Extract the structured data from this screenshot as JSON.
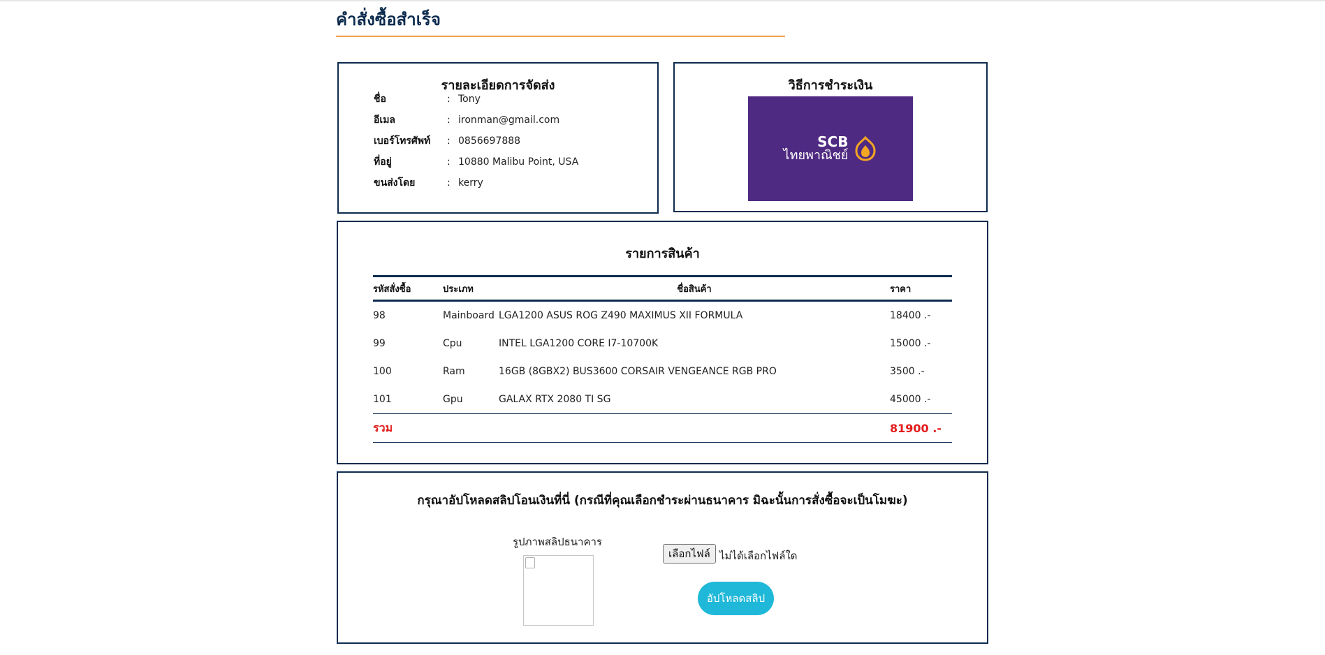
{
  "page": {
    "title": "คำสั่งซื้อสำเร็จ"
  },
  "shipping": {
    "heading": "รายละเอียดการจัดส่ง",
    "colon": ":",
    "rows": [
      {
        "label": "ชื่อ",
        "value": "Tony"
      },
      {
        "label": "อีเมล",
        "value": "ironman@gmail.com"
      },
      {
        "label": "เบอร์โทรศัพท์",
        "value": "0856697888"
      },
      {
        "label": "ที่อยู่",
        "value": "10880 Malibu Point, USA"
      },
      {
        "label": "ขนส่งโดย",
        "value": "kerry"
      }
    ]
  },
  "payment": {
    "heading": "วิธีการชำระเงิน",
    "bank": {
      "name_en": "SCB",
      "name_th": "ไทยพาณิชย์",
      "color": "#4f2a82",
      "accent": "#f5a623",
      "icon": "scb-emblem-icon"
    }
  },
  "items": {
    "heading": "รายการสินค้า",
    "columns": [
      "รหัสสั่งซื้อ",
      "ประเภท",
      "ชื่อสินค้า",
      "ราคา"
    ],
    "rows": [
      {
        "id": "98",
        "type": "Mainboard",
        "name": "LGA1200 ASUS ROG Z490 MAXIMUS XII FORMULA",
        "price": "18400 .-"
      },
      {
        "id": "99",
        "type": "Cpu",
        "name": "INTEL LGA1200 CORE I7-10700K",
        "price": "15000 .-"
      },
      {
        "id": "100",
        "type": "Ram",
        "name": "16GB (8GBX2) BUS3600 CORSAIR VENGEANCE RGB PRO",
        "price": "3500 .-"
      },
      {
        "id": "101",
        "type": "Gpu",
        "name": "GALAX RTX 2080 TI SG",
        "price": "45000 .-"
      }
    ],
    "total_label": "รวม",
    "total_value": "81900 .-"
  },
  "upload": {
    "heading": "กรุณาอัปโหลดสลิปโอนเงินที่นี่ (กรณีที่คุณเลือกชำระผ่านธนาคาร มิฉะนั้นการสั่งซื้อจะเป็นโมฆะ)",
    "slip_label": "รูปภาพสลิปธนาคาร",
    "file_button": "เลือกไฟล์",
    "file_status": "ไม่ได้เลือกไฟล์ใด",
    "upload_button": "อัปโหลดสลิป"
  }
}
